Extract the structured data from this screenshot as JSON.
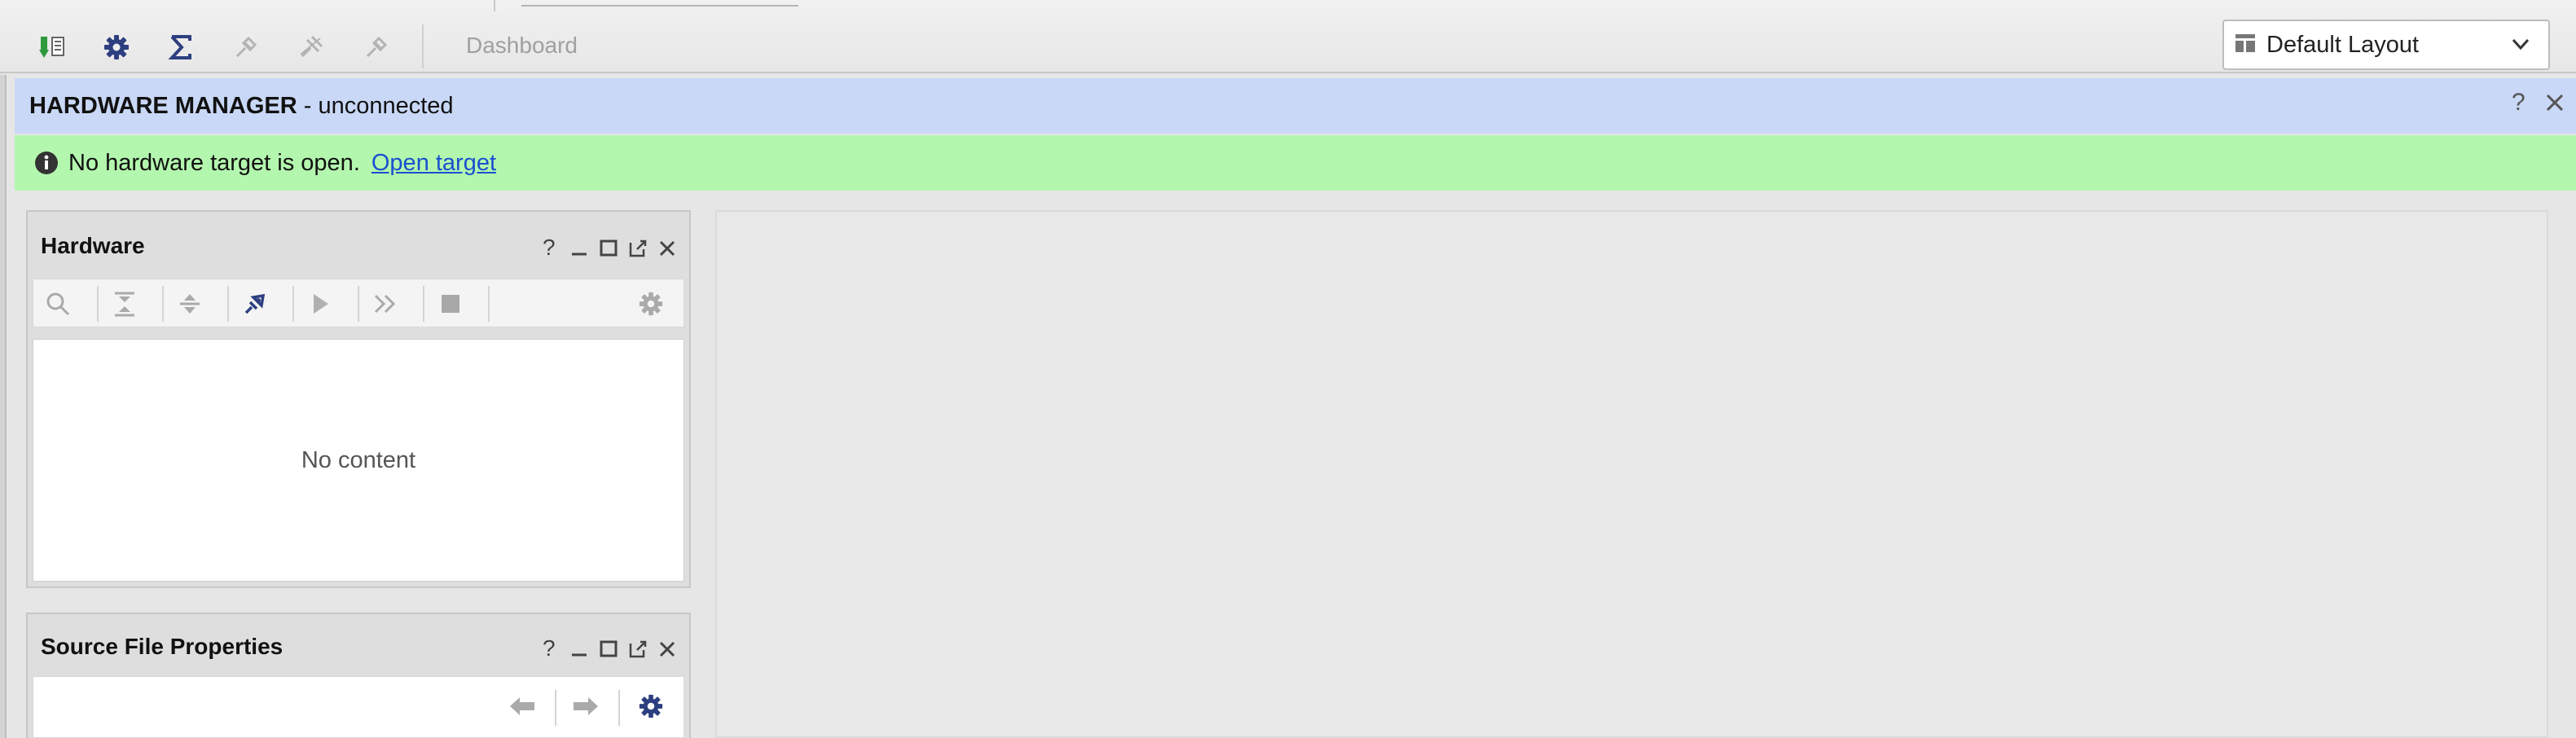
{
  "toolbar": {
    "dashboard_label": "Dashboard",
    "icons": [
      "program-device-icon",
      "gear-icon",
      "sigma-icon",
      "disabled-tool-icon",
      "disabled-tool-icon",
      "disabled-tool-icon"
    ],
    "layout_select": {
      "value": "Default Layout"
    }
  },
  "header": {
    "title": "HARDWARE MANAGER",
    "subtitle": " - unconnected"
  },
  "info": {
    "message": "No hardware target is open.",
    "link": "Open target"
  },
  "hardware_panel": {
    "title": "Hardware",
    "empty_text": "No content"
  },
  "source_panel": {
    "title": "Source File Properties"
  },
  "colors": {
    "header_bg": "#c9d8f7",
    "info_bg": "#b3f7ae",
    "link": "#1a4fd0",
    "accent_icon": "#2d3f80"
  }
}
